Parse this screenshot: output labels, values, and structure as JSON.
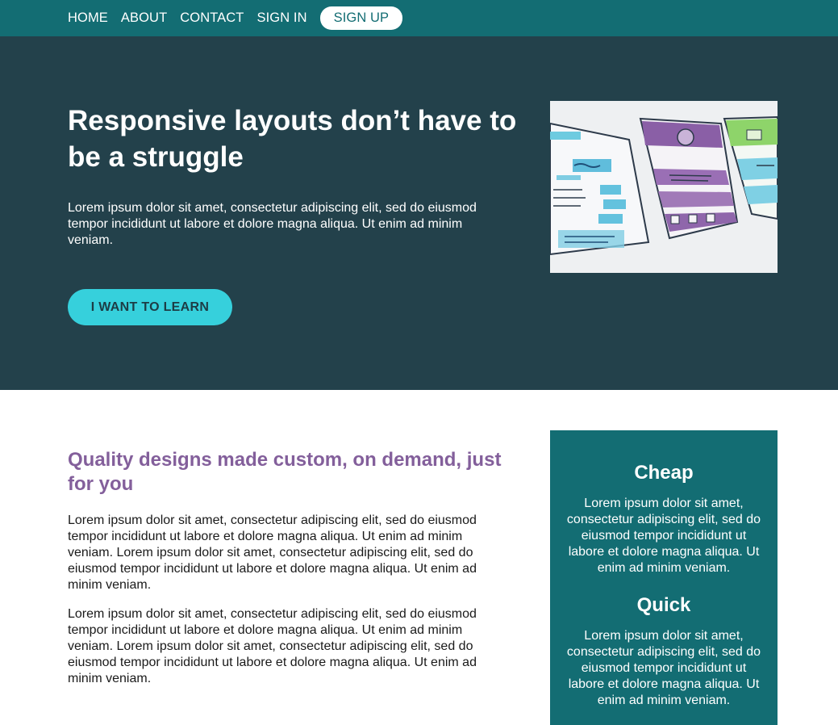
{
  "nav": {
    "home": "HOME",
    "about": "ABOUT",
    "contact": "CONTACT",
    "signin": "SIGN IN",
    "signup": "SIGN UP"
  },
  "hero": {
    "title": "Responsive layouts don’t have to be a struggle",
    "text": "Lorem ipsum dolor sit amet, consectetur adipiscing elit, sed do eiusmod tempor incididunt ut labore et dolore magna aliqua. Ut enim ad minim veniam.",
    "cta": "I WANT TO LEARN"
  },
  "main": {
    "heading": "Quality designs made custom, on demand, just for you",
    "paragraph1": "Lorem ipsum dolor sit amet, consectetur adipiscing elit, sed do eiusmod tempor incididunt ut labore et dolore magna aliqua. Ut enim ad minim veniam. Lorem ipsum dolor sit amet, consectetur adipiscing elit, sed do eiusmod tempor incididunt ut labore et dolore magna aliqua. Ut enim ad minim veniam.",
    "paragraph2": "Lorem ipsum dolor sit amet, consectetur adipiscing elit, sed do eiusmod tempor incididunt ut labore et dolore magna aliqua. Ut enim ad minim veniam. Lorem ipsum dolor sit amet, consectetur adipiscing elit, sed do eiusmod tempor incididunt ut labore et dolore magna aliqua. Ut enim ad minim veniam."
  },
  "sidebar": {
    "feature1_title": "Cheap",
    "feature1_text": "Lorem ipsum dolor sit amet, consectetur adipiscing elit, sed do eiusmod tempor incididunt ut labore et dolore magna aliqua. Ut enim ad minim veniam.",
    "feature2_title": "Quick",
    "feature2_text": "Lorem ipsum dolor sit amet, consectetur adipiscing elit, sed do eiusmod tempor incididunt ut labore et dolore magna aliqua. Ut enim ad minim veniam."
  },
  "colors": {
    "nav_bg": "#136d73",
    "hero_bg": "#23414b",
    "accent_button": "#36d0dc",
    "heading_purple": "#835f9b"
  },
  "image": {
    "subject": "wireframe-sketches-illustration"
  }
}
